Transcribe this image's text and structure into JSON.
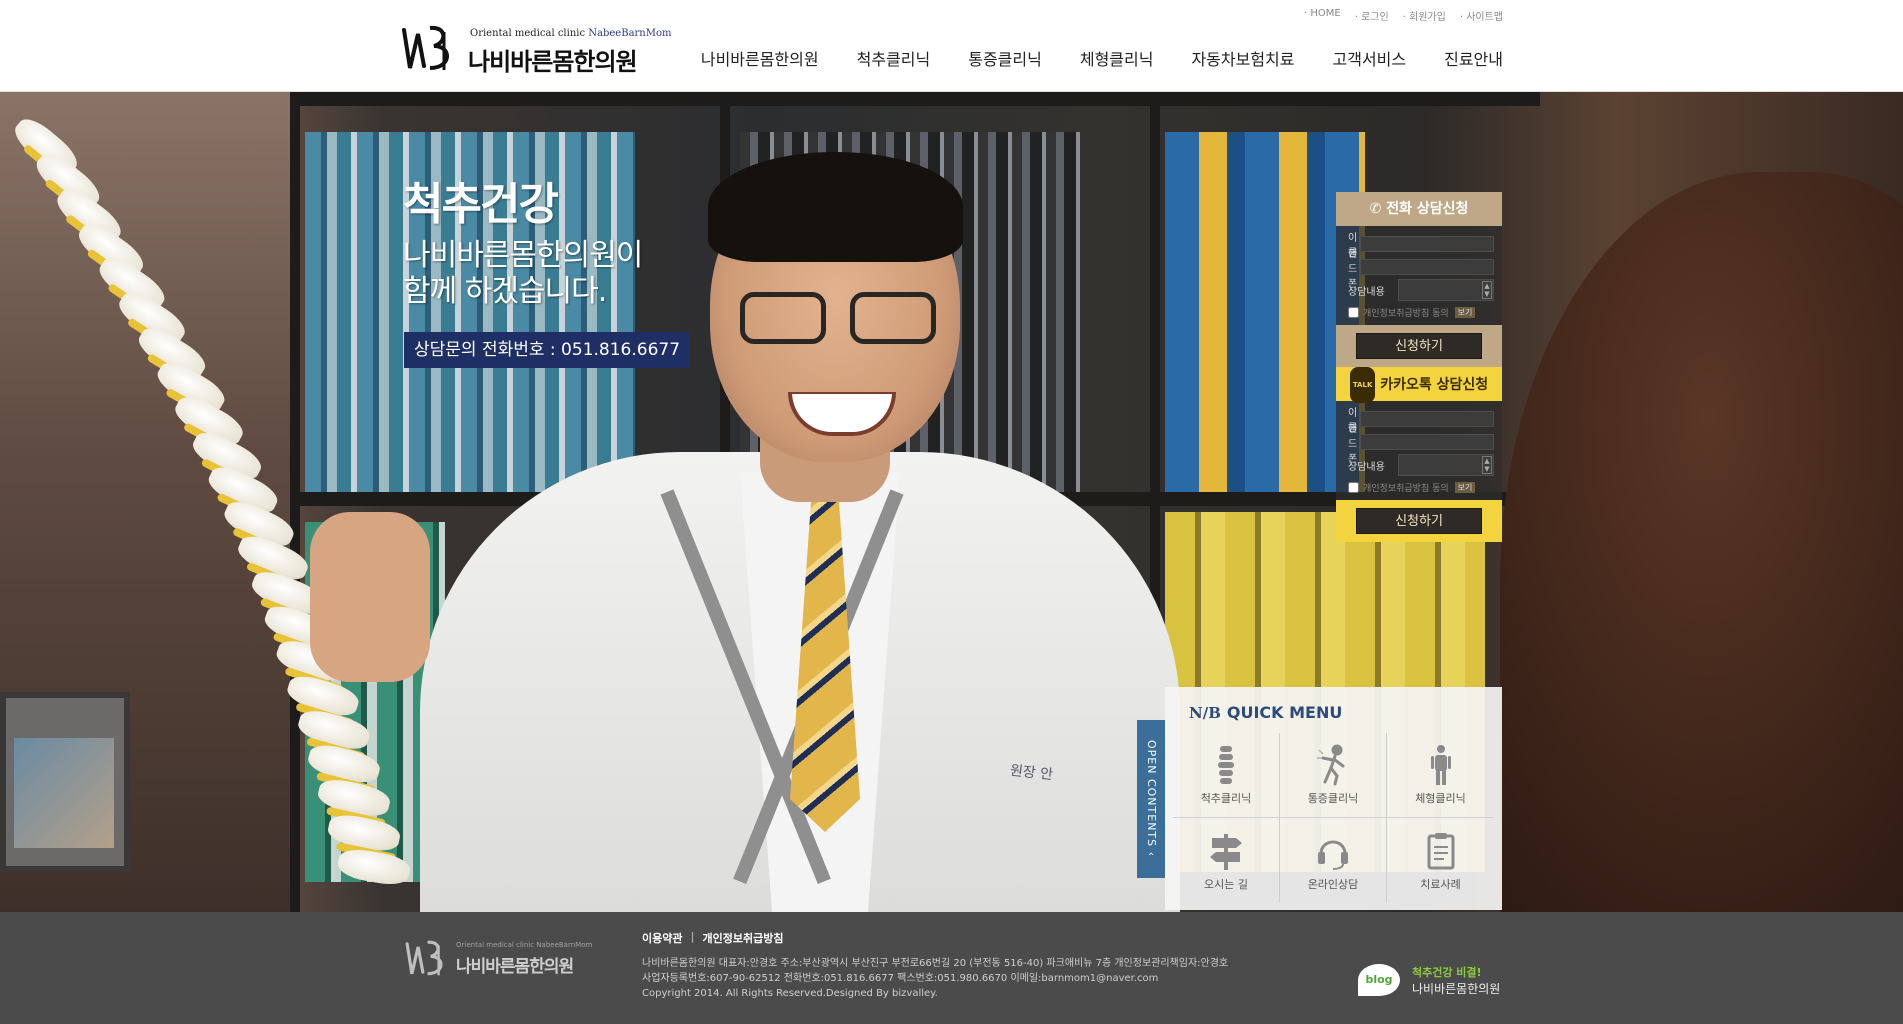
{
  "header": {
    "logo": {
      "sub_prefix": "Oriental medical clinic",
      "sub_brand": "NabeeBarnMom",
      "name": "나비바른몸한의원"
    },
    "util_links": [
      "HOME",
      "로그인",
      "회원가입",
      "사이트맵"
    ],
    "nav": [
      "나비바른몸한의원",
      "척추클리닉",
      "통증클리닉",
      "체형클리닉",
      "자동차보험치료",
      "고객서비스",
      "진료안내"
    ]
  },
  "hero": {
    "title": "척추건강",
    "subtitle": "나비바른몸한의원이\n함께 하겠습니다.",
    "phone": "상담문의 전화번호 : 051.816.6677",
    "doctor_badge": "원장 안"
  },
  "consult": {
    "phone": {
      "title": "전화 상담신청",
      "labels": {
        "name": "이름",
        "mobile": "핸드폰",
        "content": "상담내용"
      },
      "agree": "개인정보취급방침 동의",
      "view": "보기",
      "submit": "신청하기"
    },
    "kakao": {
      "title": "카카오톡 상담신청",
      "talk": "TALK",
      "labels": {
        "name": "이름",
        "mobile": "핸드폰",
        "content": "상담내용"
      },
      "agree": "개인정보취급방침 동의",
      "view": "보기",
      "submit": "신청하기"
    }
  },
  "quick": {
    "open_contents": "OPEN CONTENTS",
    "title": "QUICK MENU",
    "items": [
      "척추클리닉",
      "통증클리닉",
      "체형클리닉",
      "오시는 길",
      "온라인상담",
      "치료사례"
    ]
  },
  "footer": {
    "logo": {
      "sub": "Oriental medical clinic NabeeBarnMom",
      "name": "나비바른몸한의원"
    },
    "links": [
      "이용약관",
      "개인정보취급방침"
    ],
    "link_sep": "|",
    "info_lines": [
      "나비바른몸한의원   대표자:안경호   주소:부산광역시 부산진구 부전로66번길 20 (부전동 516-40) 파크애비뉴 7층   개인정보관리책임자:안경호",
      "사업자등록번호:607-90-62512   전화번호:051.816.6677   팩스번호:051.980.6670   이메일:barnmom1@naver.com",
      "Copyright 2014. All Rights Reserved.Designed By bizvalley."
    ],
    "blog": {
      "badge": "blog",
      "line1": "척추건강 비결!",
      "line2": "나비바른몸한의원"
    }
  },
  "colors": {
    "nav_text": "#222222",
    "hero_phone_bg": "#1f2f66",
    "consult_phone_accent": "#bfa887",
    "consult_kakao_accent": "#f3d43e",
    "quick_tab": "#3c6e9a",
    "footer_bg": "#4b4b4b"
  },
  "icons": [
    "spine-icon",
    "pain-icon",
    "body-icon",
    "signpost-icon",
    "headset-icon",
    "clipboard-icon",
    "phone-icon",
    "kakao-talk-icon"
  ]
}
